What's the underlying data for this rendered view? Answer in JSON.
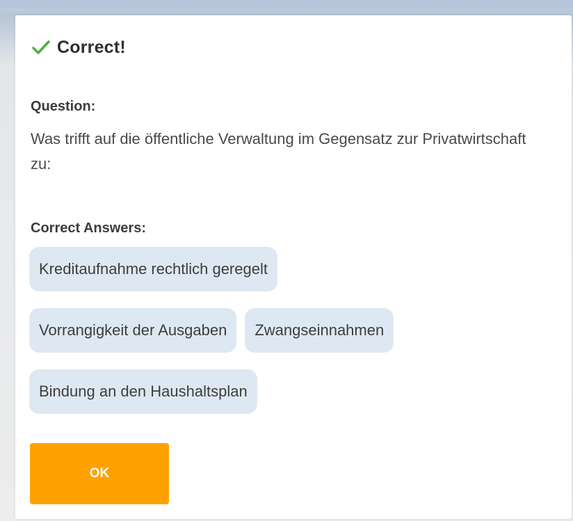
{
  "dialog": {
    "title": "Correct!",
    "title_icon": "checkmark-icon",
    "question_label": "Question:",
    "question_text": "Was trifft auf die öffentliche Verwaltung im Gegensatz zur Privatwirtschaft zu:",
    "answers_label": "Correct Answers:",
    "answers": [
      "Kreditaufnahme rechtlich geregelt",
      "Vorrangigkeit der Ausgaben",
      "Zwangseinnahmen",
      "Bindung an den Haushaltsplan"
    ],
    "ok_label": "OK"
  },
  "colors": {
    "success_check": "#4caf3c",
    "accent_button": "#ffa200",
    "chip_background": "#dee8f2"
  }
}
